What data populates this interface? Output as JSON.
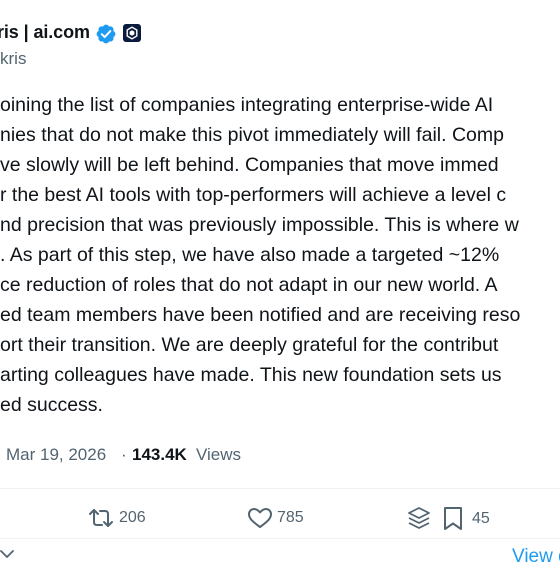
{
  "author": {
    "display_name": "ris | ai.com",
    "handle": "kris"
  },
  "tweet": {
    "lines": [
      "oining the list of companies integrating enterprise-wide AI",
      "nies that do not make this pivot immediately will fail. Comp",
      "ve slowly will be left behind. Companies that move immed",
      "r the best AI tools with top-performers will achieve a level c",
      "nd precision that was previously impossible. This is where w",
      ". As part of this step, we have also made a targeted ~12%",
      "ce reduction of roles that do not adapt in our new world. A",
      "ed team members have been notified and are receiving reso",
      "ort their transition. We are deeply grateful for the contribut",
      "arting colleagues have made. This new foundation sets us",
      "ed success."
    ]
  },
  "meta": {
    "date": "Mar 19, 2026",
    "separator": "·",
    "views_count": "143.4K",
    "views_label": "Views"
  },
  "actions": {
    "retweets": "206",
    "likes": "785",
    "bookmarks": "45"
  },
  "footer": {
    "view_link": "View q"
  },
  "icons": {
    "verified": "verified-badge-icon",
    "affiliate": "crypto-affiliate-badge-icon",
    "retweet": "retweet-icon",
    "like": "heart-icon",
    "grok": "layers-icon",
    "bookmark": "bookmark-icon",
    "chevron": "chevron-down-icon"
  },
  "colors": {
    "text": "#0f1419",
    "secondary": "#536471",
    "accent": "#1d9bf0",
    "affiliate_bg": "#0b1b3d"
  }
}
